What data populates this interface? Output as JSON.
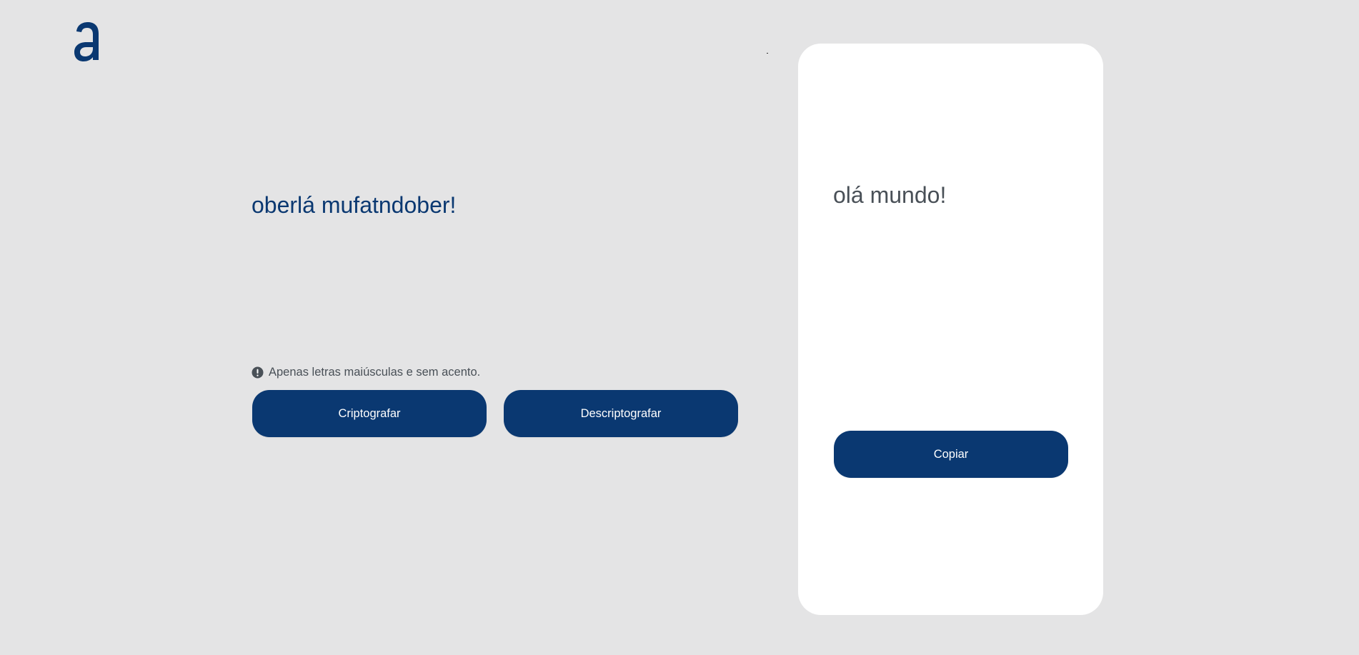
{
  "logo": {
    "icon": "alura-logo-icon",
    "color": "#0a3871"
  },
  "input": {
    "text": "oberlá mufatndober!"
  },
  "notice": {
    "icon": "exclamation-circle-icon",
    "text": "Apenas letras maiúsculas e sem acento."
  },
  "buttons": {
    "encrypt_label": "Criptografar",
    "decrypt_label": "Descriptografar"
  },
  "output": {
    "text": "olá mundo!",
    "copy_label": "Copiar"
  },
  "colors": {
    "background": "#e4e4e5",
    "accent": "#0a3871",
    "panel": "#ffffff",
    "muted_text": "#495057"
  }
}
